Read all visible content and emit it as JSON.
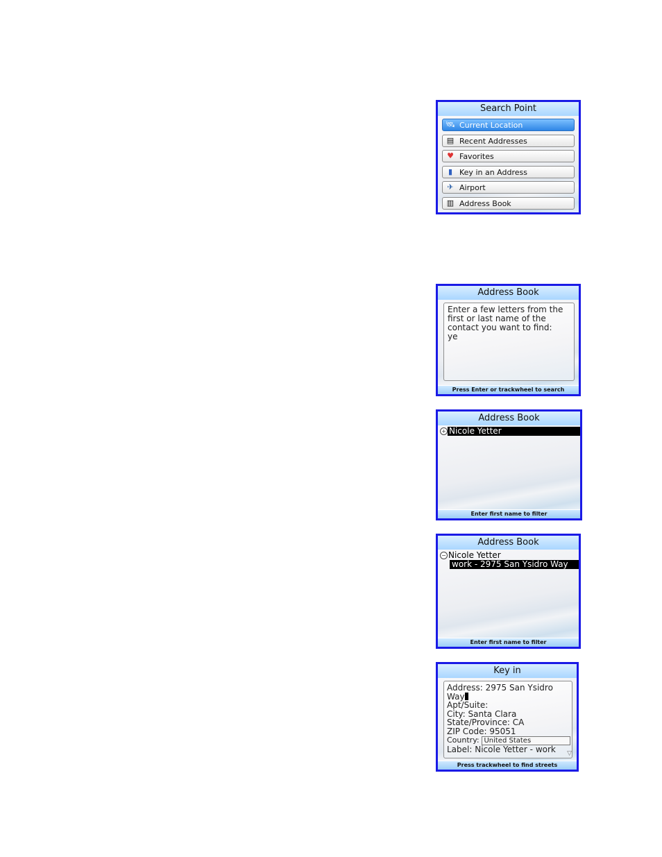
{
  "search_point": {
    "title": "Search Point",
    "items": [
      {
        "label": "Current Location",
        "icon": "satellite-icon",
        "selected": true
      },
      {
        "label": "Recent Addresses",
        "icon": "recent-icon",
        "selected": false
      },
      {
        "label": "Favorites",
        "icon": "favorites-icon",
        "selected": false
      },
      {
        "label": "Key in an Address",
        "icon": "keypad-phone-icon",
        "selected": false
      },
      {
        "label": "Airport",
        "icon": "airplane-icon",
        "selected": false
      },
      {
        "label": "Address Book",
        "icon": "address-book-icon",
        "selected": false
      }
    ]
  },
  "address_book_search": {
    "title": "Address Book",
    "prompt": "Enter a few letters from the first or last name of the contact you want to find:",
    "input_value": "ye",
    "footer": "Press Enter or trackwheel to search"
  },
  "address_book_results": {
    "title": "Address Book",
    "contact": "Nicole Yetter",
    "footer": "Enter first name to filter"
  },
  "address_book_expanded": {
    "title": "Address Book",
    "contact": "Nicole Yetter",
    "address": "work - 2975 San Ysidro Way",
    "footer": "Enter first name to filter"
  },
  "key_in": {
    "title": "Key in",
    "address_line1": "Address: 2975 San Ysidro",
    "address_line2": "Way",
    "apt": "Apt/Suite:",
    "city": "City: Santa Clara",
    "state": "State/Province: CA",
    "zip": "ZIP Code: 95051",
    "country_label": "Country:",
    "country_value": "United States",
    "label": "Label: Nicole Yetter - work",
    "footer": "Press trackwheel to find streets"
  },
  "colors": {
    "frame": "#1a1ae6",
    "title_bar": "#a9d6ff",
    "selected_item": "#2f86e6",
    "highlight": "#000000"
  }
}
